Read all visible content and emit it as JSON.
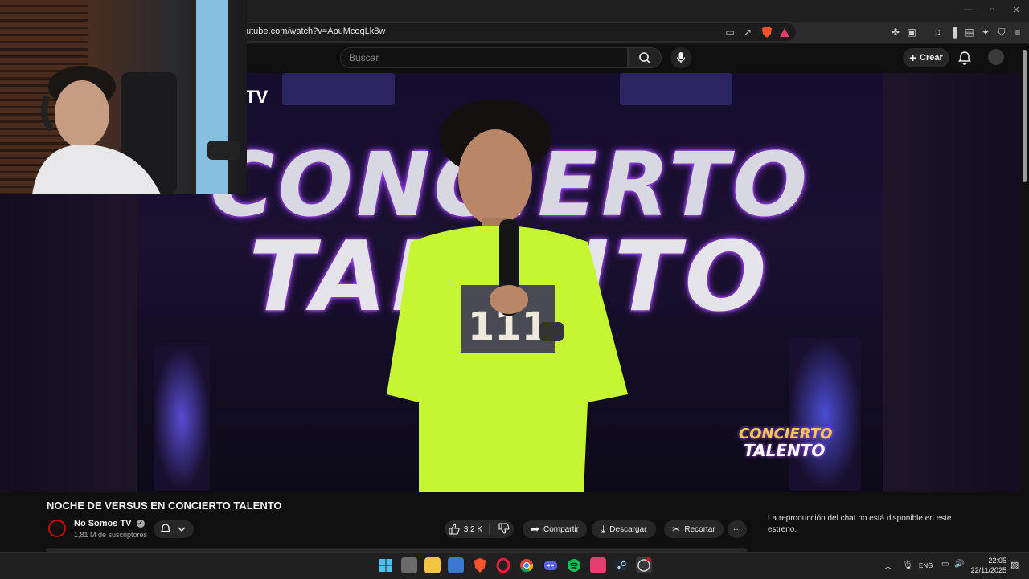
{
  "browser": {
    "url": "utube.com/watch?v=ApuMcoqLk8w"
  },
  "youtube": {
    "search_placeholder": "Buscar",
    "create_label": "Crear",
    "video_overlay_channel_partial": "TV",
    "stage_text_line1": "CONCIERTO",
    "stage_text_line2": "TALENTO",
    "overlay_logo_line1": "CONCIERTO",
    "overlay_logo_line2": "TALENTO",
    "shirt_text": "111",
    "video_title": "NOCHE DE VERSUS EN CONCIERTO TALENTO",
    "channel_name": "No Somos TV",
    "subscribers": "1,81 M de suscriptores",
    "likes": "3,2 K",
    "share_label": "Compartir",
    "download_label": "Descargar",
    "clip_label": "Recortar",
    "more_label": "···",
    "chat_note": "La reproducción del chat no está disponible en este estreno."
  },
  "taskbar": {
    "language": "ENG",
    "time": "22:05",
    "date": "22/11/2025",
    "app_icons": [
      "windows-start-icon",
      "task-view-icon",
      "file-explorer-icon",
      "store-icon",
      "brave-icon",
      "opera-icon",
      "chrome-icon",
      "discord-icon",
      "spotify-icon",
      "app-icon",
      "steam-icon",
      "obs-icon"
    ]
  },
  "colors": {
    "youtube_bg": "#0f0f0f",
    "pill_bg": "#272727",
    "shirt": "#c6f532",
    "neon_purple": "#9b3cff",
    "brave_orange": "#fb542b"
  }
}
